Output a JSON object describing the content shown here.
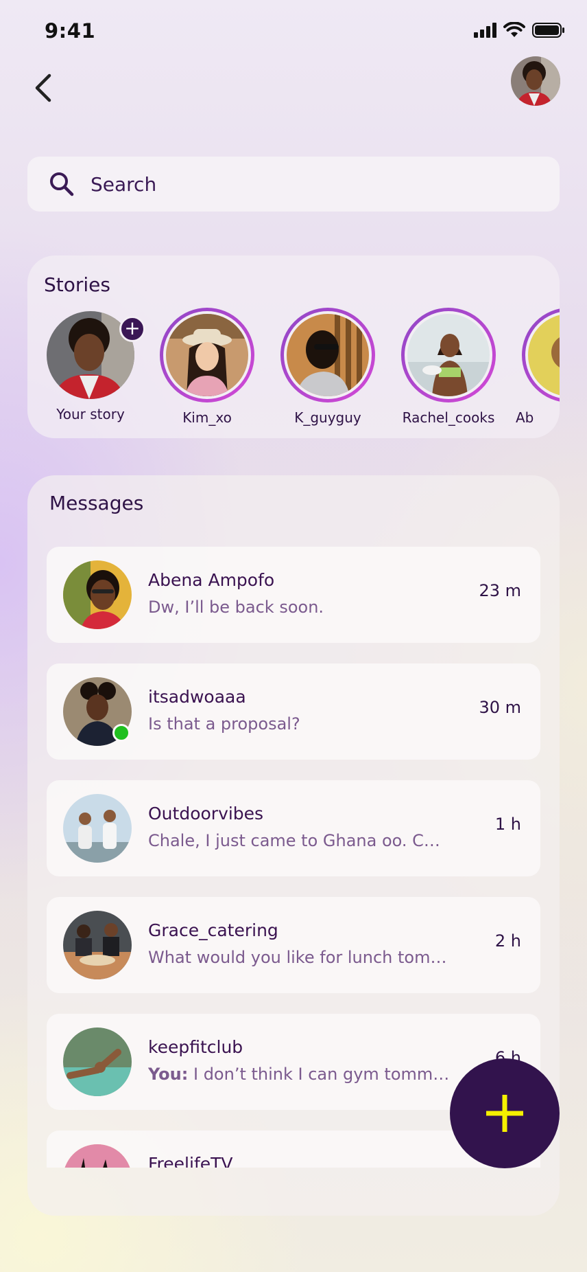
{
  "status_bar": {
    "time": "9:41"
  },
  "search": {
    "placeholder": "Search"
  },
  "stories": {
    "title": "Stories",
    "items": [
      {
        "label": "Your story"
      },
      {
        "label": "Kim_xo"
      },
      {
        "label": "K_guyguy"
      },
      {
        "label": "Rachel_cooks"
      },
      {
        "label": "Ab"
      }
    ]
  },
  "messages": {
    "title": "Messages",
    "items": [
      {
        "name": "Abena Ampofo",
        "preview": "Dw, I’ll be back soon.",
        "time": "23 m"
      },
      {
        "name": "itsadwoaaa",
        "preview": "Is that a proposal?",
        "time": "30 m"
      },
      {
        "name": "Outdoorvibes",
        "preview": "Chale, I just came to Ghana oo. Can...",
        "time": "1 h"
      },
      {
        "name": "Grace_catering",
        "preview": "What would  you like for lunch tomo...",
        "time": "2 h"
      },
      {
        "name": "keepfitclub",
        "prefix": "You:",
        "preview": " I don’t think I can gym tommor...",
        "time": "6 h"
      },
      {
        "name": "FreelifeTV",
        "preview": "",
        "time": ""
      }
    ]
  },
  "colors": {
    "accent": "#32134d",
    "fab_icon": "#f5f000",
    "story_ring_start": "#8f47c6",
    "story_ring_end": "#d448d6",
    "online": "#1fbf1f"
  },
  "icons": {
    "back": "chevron-left-icon",
    "search": "search-icon",
    "add_story": "plus-icon",
    "new_message": "plus-icon"
  }
}
